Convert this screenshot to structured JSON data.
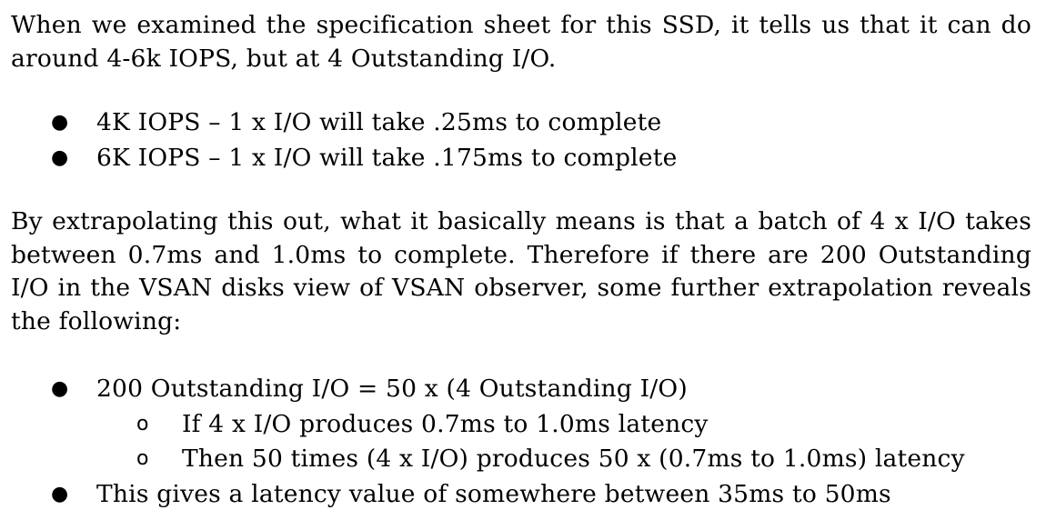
{
  "paragraphs": {
    "p1": "When we examined the specification sheet for this SSD, it tells us that it can do around 4-6k IOPS, but at 4 Outstanding I/O.",
    "p2": "By extrapolating this out, what it basically means is that a batch of 4 x I/O takes between 0.7ms and 1.0ms to complete. Therefore if there are 200 Outstanding I/O in the VSAN disks view of VSAN observer, some further extrapolation reveals the following:"
  },
  "bullets": {
    "level1_glyph": "●",
    "level2_glyph": "o"
  },
  "list1": [
    "4K IOPS – 1 x I/O will take .25ms to complete",
    "6K IOPS – 1 x I/O will take .175ms to complete"
  ],
  "list2": {
    "item1": "200 Outstanding I/O = 50 x (4 Outstanding I/O)",
    "sub1": "If 4 x I/O produces 0.7ms to 1.0ms latency",
    "sub2": "Then 50 times (4 x I/O) produces 50 x (0.7ms to 1.0ms) latency",
    "item2": "This gives a latency value of somewhere between 35ms to 50ms"
  }
}
